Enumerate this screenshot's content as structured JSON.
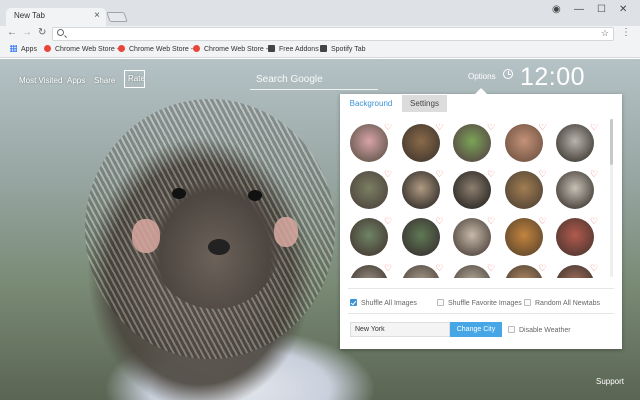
{
  "browser": {
    "tab_title": "New Tab",
    "tab_close": "×",
    "window_controls": {
      "account": "◉",
      "minimize": "—",
      "maximize": "☐",
      "close": "✕"
    },
    "back": "←",
    "forward": "→",
    "reload": "↻",
    "url_value": "",
    "star": "☆",
    "menu": "⋮",
    "bookmarks": [
      {
        "label": "Apps",
        "icon": "apps-grid-icon"
      },
      {
        "label": "Chrome Web Store -",
        "icon": "chrome-store-icon"
      },
      {
        "label": "Chrome Web Store -",
        "icon": "chrome-store-icon"
      },
      {
        "label": "Chrome Web Store -",
        "icon": "chrome-store-icon"
      },
      {
        "label": "Free Addons",
        "icon": "addons-icon"
      },
      {
        "label": "Spotify Tab",
        "icon": "spotify-icon"
      }
    ]
  },
  "topnav": {
    "most_visited": "Most Visited",
    "apps": "Apps",
    "share": "Share",
    "rate": "Rate"
  },
  "search": {
    "placeholder": "Search Google"
  },
  "options_label": "Options",
  "clock": "12:00",
  "support": "Support",
  "panel": {
    "tabs": [
      "Background",
      "Settings"
    ],
    "thumbnails_visible_rows": 4,
    "options": {
      "shuffle_all": "Shuffle All Images",
      "shuffle_favorite": "Shuffle Favorite Images",
      "random_all": "Random All Newtabs",
      "disable_weather": "Disable Weather"
    },
    "city_value": "New York",
    "change_city": "Change City"
  },
  "colors": {
    "accent": "#3a93d6",
    "heart": "#ef6a5a",
    "button": "#47a6e6"
  }
}
